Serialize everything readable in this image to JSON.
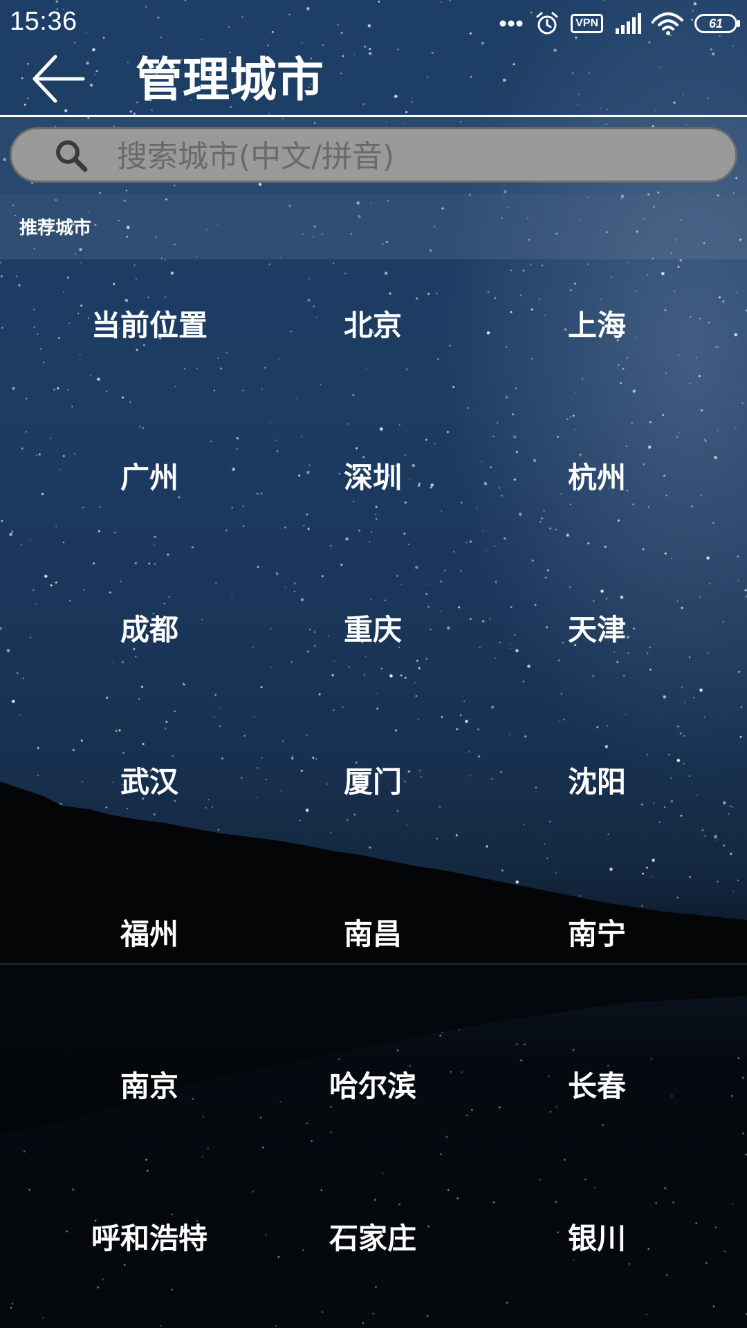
{
  "status_bar": {
    "time": "15:36",
    "icons": [
      "more-dots-icon",
      "alarm-icon",
      "vpn-icon",
      "signal-icon",
      "wifi-icon",
      "battery-icon"
    ],
    "vpn_label": "VPN",
    "battery_level": "61"
  },
  "header": {
    "back_icon": "arrow-left-icon",
    "title": "管理城市"
  },
  "search": {
    "icon": "search-icon",
    "placeholder": "搜索城市(中文/拼音)",
    "value": ""
  },
  "section": {
    "title": "推荐城市"
  },
  "cities": [
    "当前位置",
    "北京",
    "上海",
    "广州",
    "深圳",
    "杭州",
    "成都",
    "重庆",
    "天津",
    "武汉",
    "厦门",
    "沈阳",
    "福州",
    "南昌",
    "南宁",
    "南京",
    "哈尔滨",
    "长春",
    "呼和浩特",
    "石家庄",
    "银川"
  ],
  "colors": {
    "text": "#ffffff",
    "search_bg": "#9a9a9a",
    "sky_top": "#1d3e66"
  }
}
